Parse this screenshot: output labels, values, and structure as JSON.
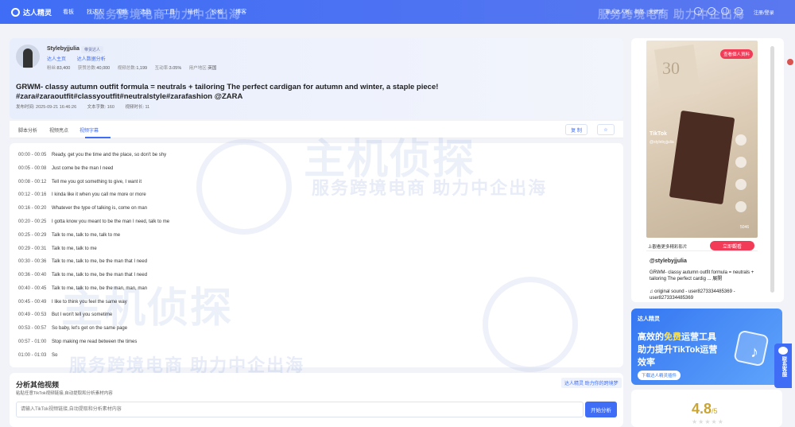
{
  "topbar": {
    "brand": "达人精灵",
    "nav": [
      "看板",
      "找达人",
      "视频",
      "选品",
      "工具",
      "插件",
      "价格",
      "博客"
    ],
    "watermark": "服务跨境电商 助力中企出海",
    "search_placeholder": "输入达人名、商品、关键词",
    "login": "注册/登录"
  },
  "creator": {
    "name": "Stylebyjjulia",
    "badge": "带货达人",
    "links": [
      "达人主页",
      "达人数据分析"
    ],
    "stats": [
      {
        "label": "粉丝:",
        "value": "83,400"
      },
      {
        "label": "获赞总数:",
        "value": "40,000"
      },
      {
        "label": "视频总数:",
        "value": "1,199"
      },
      {
        "label": "互动率:",
        "value": "3.05%"
      },
      {
        "label": "用户地区:",
        "value": "英国"
      }
    ]
  },
  "video": {
    "title": "GRWM- classy autumn outfit formula = neutrals + tailoring The perfect cardigan for autumn and winter, a staple piece! #zara#zaraoutfit#classyoutfit#neutralstyle#zarafashion @ZARA",
    "publish_time": "发布时间: 2025-09-21 16:46:26",
    "word_count": "文本字数: 160",
    "duration": "视频时长: 11"
  },
  "tabs": {
    "items": [
      "脚本分析",
      "视频亮点",
      "视频字幕"
    ],
    "active": "视频字幕",
    "copy": "复 制",
    "star": "☆"
  },
  "subtitles": [
    {
      "t": "00:00 - 00:05",
      "text": "Ready, get you the time and the place, so don't be shy"
    },
    {
      "t": "00:05 - 00:08",
      "text": "Just come be the man I need"
    },
    {
      "t": "00:08 - 00:12",
      "text": "Tell me you got something to give, I want it"
    },
    {
      "t": "00:12 - 00:16",
      "text": "I kinda like it when you call me more or more"
    },
    {
      "t": "00:16 - 00:20",
      "text": "Whatever the type of talking is, come on man"
    },
    {
      "t": "00:20 - 00:25",
      "text": "I gotta know you meant to be the man I need, talk to me"
    },
    {
      "t": "00:25 - 00:29",
      "text": "Talk to me, talk to me, talk to me"
    },
    {
      "t": "00:29 - 00:31",
      "text": "Talk to me, talk to me"
    },
    {
      "t": "00:30 - 00:36",
      "text": "Talk to me, talk to me, be the man that I need"
    },
    {
      "t": "00:36 - 00:40",
      "text": "Talk to me, talk to me, be the man that I need"
    },
    {
      "t": "00:40 - 00:45",
      "text": "Talk to me, talk to me, be the man, man, man"
    },
    {
      "t": "00:45 - 00:49",
      "text": "I like to think you feel the same way"
    },
    {
      "t": "00:49 - 00:53",
      "text": "But I won't tell you sometime"
    },
    {
      "t": "00:53 - 00:57",
      "text": "So baby, let's get on the same page"
    },
    {
      "t": "00:57 - 01:00",
      "text": "Stop making me read between the times"
    },
    {
      "t": "01:00 - 01:03",
      "text": "So"
    }
  ],
  "watermark": {
    "brand": "主机侦探",
    "slogan": "服务跨境电商 助力中企出海"
  },
  "analyze": {
    "title": "分析其他视频",
    "hint": "粘贴任意TikTok视频链接,自动提取和分析素材内容",
    "tag": "达人精灵 助力你的跨境梦",
    "placeholder": "请输入TikTok视频链接,自动提取和分析素材内容",
    "button": "开始分析"
  },
  "preview": {
    "badge": "查看個人資料",
    "bag_text": "30",
    "platform": "TikTok",
    "handle": "@stylebyjjulia",
    "count": "5046",
    "more_label": "上觀看更多精彩影片",
    "watch_button": "立即觀看",
    "username": "@stylebyjjulia",
    "description": "GRWM- classy autumn outfit formula = neutrals + tailoring The perfect cardig ... 展開",
    "sound": "♫ original sound - user8273334485369 - user8273334485369"
  },
  "promo": {
    "brand": "达人精灵",
    "line1_pre": "高效的",
    "line1_hl": "免费",
    "line1_post": "运营工具",
    "line2": "助力提升TikTok运营",
    "line3": "效率",
    "button": "下载达人精灵插件"
  },
  "rating": {
    "score": "4.8",
    "denominator": "/5",
    "stars": "★★★★★"
  },
  "float": {
    "label": "联系客服"
  },
  "colors": {
    "accent": "#3f6df5",
    "red": "#f23b57",
    "gold": "#c9a436"
  }
}
